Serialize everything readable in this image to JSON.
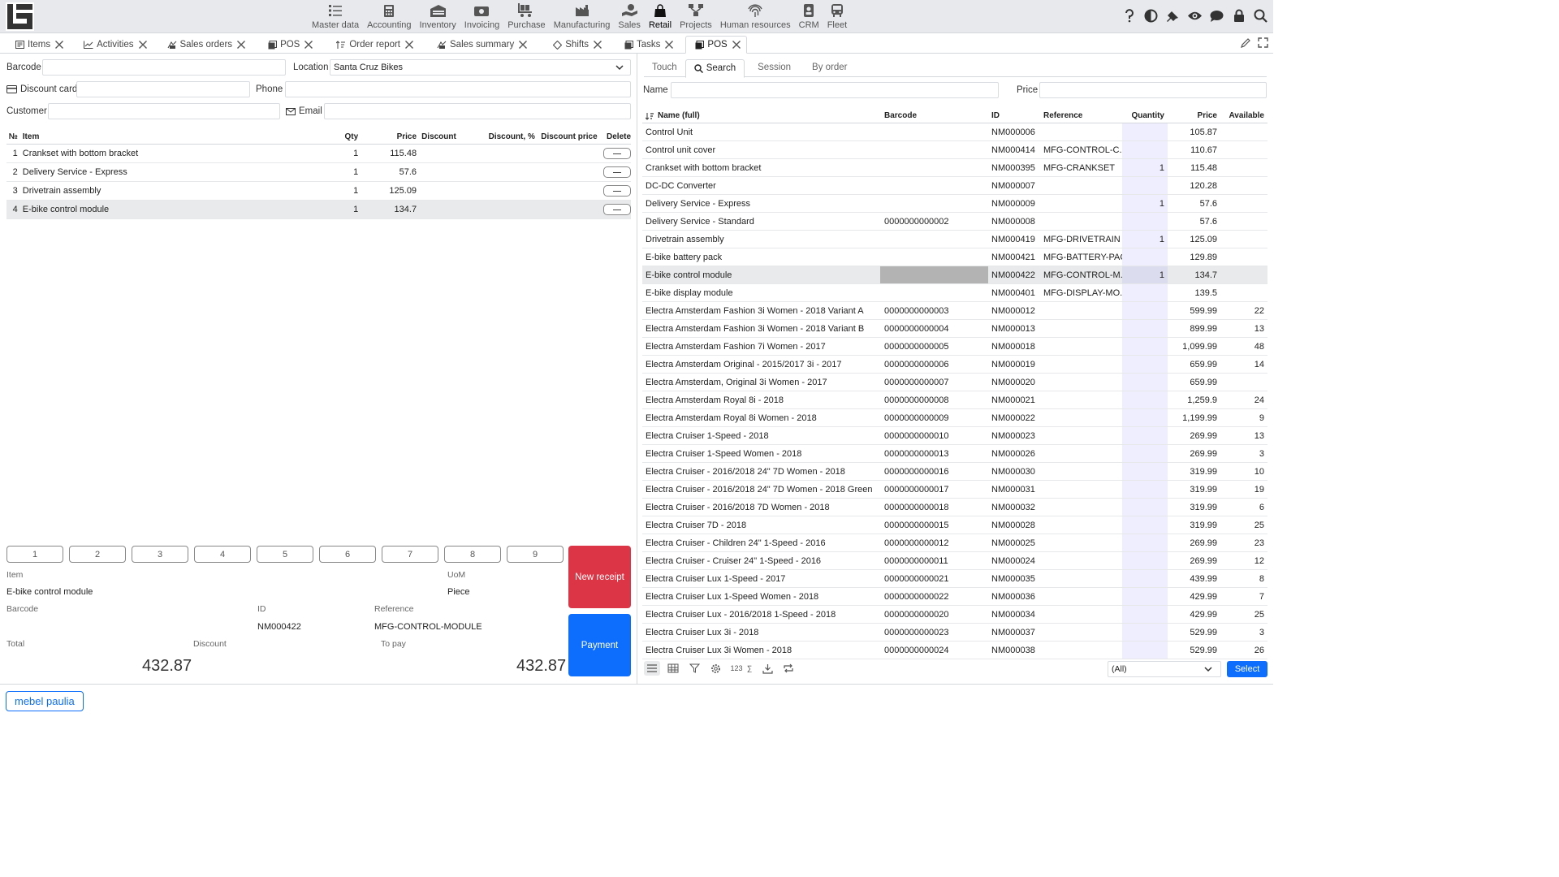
{
  "modules": [
    {
      "label": "Master data",
      "icon": "master-data-icon"
    },
    {
      "label": "Accounting",
      "icon": "accounting-icon"
    },
    {
      "label": "Inventory",
      "icon": "inventory-icon"
    },
    {
      "label": "Invoicing",
      "icon": "invoicing-icon"
    },
    {
      "label": "Purchase",
      "icon": "purchase-icon"
    },
    {
      "label": "Manufacturing",
      "icon": "manufacturing-icon"
    },
    {
      "label": "Sales",
      "icon": "sales-icon"
    },
    {
      "label": "Retail",
      "icon": "retail-icon",
      "active": true
    },
    {
      "label": "Projects",
      "icon": "projects-icon"
    },
    {
      "label": "Human resources",
      "icon": "fingerprint-icon"
    },
    {
      "label": "CRM",
      "icon": "crm-icon"
    },
    {
      "label": "Fleet",
      "icon": "fleet-icon"
    }
  ],
  "tabs": [
    {
      "label": "Items"
    },
    {
      "label": "Activities"
    },
    {
      "label": "Sales orders"
    },
    {
      "label": "POS"
    },
    {
      "label": "Order report"
    },
    {
      "label": "Sales summary"
    },
    {
      "label": "Shifts"
    },
    {
      "label": "Tasks"
    },
    {
      "label": "POS",
      "active": true
    }
  ],
  "left": {
    "barcode_label": "Barcode",
    "barcode_value": "",
    "location_label": "Location",
    "location_value": "Santa Cruz Bikes",
    "discount_card_label": "Discount card",
    "discount_card_value": "",
    "phone_label": "Phone",
    "phone_value": "",
    "customer_label": "Customer",
    "customer_value": "",
    "email_label": "Email",
    "email_value": "",
    "table_headers": {
      "n": "№",
      "item": "Item",
      "qty": "Qty",
      "price": "Price",
      "discount": "Discount",
      "discount_pct": "Discount, %",
      "discount_price": "Discount price",
      "delete": "Delete"
    },
    "rows": [
      {
        "n": "1",
        "item": "Crankset with bottom bracket",
        "qty": "1",
        "price": "115.48"
      },
      {
        "n": "2",
        "item": "Delivery Service - Express",
        "qty": "1",
        "price": "57.6"
      },
      {
        "n": "3",
        "item": "Drivetrain assembly",
        "qty": "1",
        "price": "125.09"
      },
      {
        "n": "4",
        "item": "E-bike control module",
        "qty": "1",
        "price": "134.7",
        "selected": true
      }
    ],
    "numpad": [
      "1",
      "2",
      "3",
      "4",
      "5",
      "6",
      "7",
      "8",
      "9"
    ],
    "item_label": "Item",
    "item_value": "E-bike control module",
    "uom_label": "UoM",
    "uom_value": "Piece",
    "barcode2_label": "Barcode",
    "id_label": "ID",
    "id_value": "NM000422",
    "reference_label": "Reference",
    "reference_value": "MFG-CONTROL-MODULE",
    "total_label": "Total",
    "total_value": "432.87",
    "discount_label": "Discount",
    "topay_label": "To pay",
    "topay_value": "432.87",
    "new_receipt": "New receipt",
    "payment": "Payment"
  },
  "right": {
    "tabs": [
      {
        "label": "Touch"
      },
      {
        "label": "Search",
        "active": true,
        "icon": "search-icon"
      },
      {
        "label": "Session"
      },
      {
        "label": "By order"
      }
    ],
    "name_label": "Name",
    "name_value": "",
    "price_label": "Price",
    "price_value": "",
    "headers": {
      "name": "Name (full)",
      "barcode": "Barcode",
      "id": "ID",
      "reference": "Reference",
      "quantity": "Quantity",
      "price": "Price",
      "available": "Available"
    },
    "rows": [
      {
        "name": "Control Unit",
        "barcode": "",
        "id": "NM000006",
        "ref": "",
        "qty": "",
        "price": "105.87",
        "avail": ""
      },
      {
        "name": "Control unit cover",
        "barcode": "",
        "id": "NM000414",
        "ref": "MFG-CONTROL-C...",
        "qty": "",
        "price": "110.67",
        "avail": ""
      },
      {
        "name": "Crankset with bottom bracket",
        "barcode": "",
        "id": "NM000395",
        "ref": "MFG-CRANKSET",
        "qty": "1",
        "price": "115.48",
        "avail": ""
      },
      {
        "name": "DC-DC Converter",
        "barcode": "",
        "id": "NM000007",
        "ref": "",
        "qty": "",
        "price": "120.28",
        "avail": ""
      },
      {
        "name": "Delivery Service - Express",
        "barcode": "",
        "id": "NM000009",
        "ref": "",
        "qty": "1",
        "price": "57.6",
        "avail": ""
      },
      {
        "name": "Delivery Service - Standard",
        "barcode": "0000000000002",
        "id": "NM000008",
        "ref": "",
        "qty": "",
        "price": "57.6",
        "avail": ""
      },
      {
        "name": "Drivetrain assembly",
        "barcode": "",
        "id": "NM000419",
        "ref": "MFG-DRIVETRAIN",
        "qty": "1",
        "price": "125.09",
        "avail": ""
      },
      {
        "name": "E-bike battery pack",
        "barcode": "",
        "id": "NM000421",
        "ref": "MFG-BATTERY-PACK",
        "qty": "",
        "price": "129.89",
        "avail": ""
      },
      {
        "name": "E-bike control module",
        "barcode": "",
        "id": "NM000422",
        "ref": "MFG-CONTROL-M...",
        "qty": "1",
        "price": "134.7",
        "avail": "",
        "selected": true
      },
      {
        "name": "E-bike display module",
        "barcode": "",
        "id": "NM000401",
        "ref": "MFG-DISPLAY-MO...",
        "qty": "",
        "price": "139.5",
        "avail": ""
      },
      {
        "name": "Electra Amsterdam Fashion 3i Women - 2018 Variant A",
        "barcode": "0000000000003",
        "id": "NM000012",
        "ref": "",
        "qty": "",
        "price": "599.99",
        "avail": "22"
      },
      {
        "name": "Electra Amsterdam Fashion 3i Women - 2018 Variant B",
        "barcode": "0000000000004",
        "id": "NM000013",
        "ref": "",
        "qty": "",
        "price": "899.99",
        "avail": "13"
      },
      {
        "name": "Electra Amsterdam Fashion 7i Women - 2017",
        "barcode": "0000000000005",
        "id": "NM000018",
        "ref": "",
        "qty": "",
        "price": "1,099.99",
        "avail": "48"
      },
      {
        "name": "Electra Amsterdam Original - 2015/2017 3i - 2017",
        "barcode": "0000000000006",
        "id": "NM000019",
        "ref": "",
        "qty": "",
        "price": "659.99",
        "avail": "14"
      },
      {
        "name": "Electra Amsterdam, Original 3i Women - 2017",
        "barcode": "0000000000007",
        "id": "NM000020",
        "ref": "",
        "qty": "",
        "price": "659.99",
        "avail": ""
      },
      {
        "name": "Electra Amsterdam Royal 8i - 2018",
        "barcode": "0000000000008",
        "id": "NM000021",
        "ref": "",
        "qty": "",
        "price": "1,259.9",
        "avail": "24"
      },
      {
        "name": "Electra Amsterdam Royal 8i Women - 2018",
        "barcode": "0000000000009",
        "id": "NM000022",
        "ref": "",
        "qty": "",
        "price": "1,199.99",
        "avail": "9"
      },
      {
        "name": "Electra Cruiser 1-Speed - 2018",
        "barcode": "0000000000010",
        "id": "NM000023",
        "ref": "",
        "qty": "",
        "price": "269.99",
        "avail": "13"
      },
      {
        "name": "Electra Cruiser 1-Speed Women - 2018",
        "barcode": "0000000000013",
        "id": "NM000026",
        "ref": "",
        "qty": "",
        "price": "269.99",
        "avail": "3"
      },
      {
        "name": "Electra Cruiser - 2016/2018 24\" 7D Women - 2018",
        "barcode": "0000000000016",
        "id": "NM000030",
        "ref": "",
        "qty": "",
        "price": "319.99",
        "avail": "10"
      },
      {
        "name": "Electra Cruiser - 2016/2018 24\" 7D Women - 2018 Green",
        "barcode": "0000000000017",
        "id": "NM000031",
        "ref": "",
        "qty": "",
        "price": "319.99",
        "avail": "19"
      },
      {
        "name": "Electra Cruiser - 2016/2018 7D Women - 2018",
        "barcode": "0000000000018",
        "id": "NM000032",
        "ref": "",
        "qty": "",
        "price": "319.99",
        "avail": "6"
      },
      {
        "name": "Electra Cruiser 7D - 2018",
        "barcode": "0000000000015",
        "id": "NM000028",
        "ref": "",
        "qty": "",
        "price": "319.99",
        "avail": "25"
      },
      {
        "name": "Electra Cruiser - Children 24\" 1-Speed - 2016",
        "barcode": "0000000000012",
        "id": "NM000025",
        "ref": "",
        "qty": "",
        "price": "269.99",
        "avail": "23"
      },
      {
        "name": "Electra Cruiser - Cruiser 24\" 1-Speed - 2016",
        "barcode": "0000000000011",
        "id": "NM000024",
        "ref": "",
        "qty": "",
        "price": "269.99",
        "avail": "12"
      },
      {
        "name": "Electra Cruiser Lux 1-Speed - 2017",
        "barcode": "0000000000021",
        "id": "NM000035",
        "ref": "",
        "qty": "",
        "price": "439.99",
        "avail": "8"
      },
      {
        "name": "Electra Cruiser Lux 1-Speed Women - 2018",
        "barcode": "0000000000022",
        "id": "NM000036",
        "ref": "",
        "qty": "",
        "price": "429.99",
        "avail": "7"
      },
      {
        "name": "Electra Cruiser Lux - 2016/2018 1-Speed - 2018",
        "barcode": "0000000000020",
        "id": "NM000034",
        "ref": "",
        "qty": "",
        "price": "429.99",
        "avail": "25"
      },
      {
        "name": "Electra Cruiser Lux 3i - 2018",
        "barcode": "0000000000023",
        "id": "NM000037",
        "ref": "",
        "qty": "",
        "price": "529.99",
        "avail": "3"
      },
      {
        "name": "Electra Cruiser Lux 3i Women - 2018",
        "barcode": "0000000000024",
        "id": "NM000038",
        "ref": "",
        "qty": "",
        "price": "529.99",
        "avail": "26"
      }
    ],
    "footer_icons": [
      "list-view-icon",
      "table-view-icon",
      "filter-icon",
      "settings-icon",
      "numbers-icon",
      "sum-icon",
      "download-icon",
      "refresh-icon"
    ],
    "numbers_glyph": "123",
    "sum_glyph": "∑",
    "filter_value": "(All)",
    "select_label": "Select"
  },
  "user": "mebel paulia",
  "colors": {
    "danger": "#dc3545",
    "primary": "#0d6efd"
  }
}
